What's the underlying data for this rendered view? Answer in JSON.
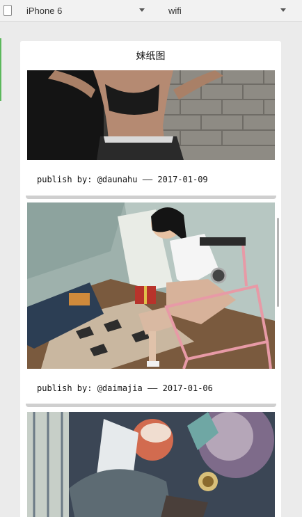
{
  "toolbar": {
    "device": "iPhone 6",
    "network": "wifi"
  },
  "page": {
    "title": "妹纸图"
  },
  "posts": [
    {
      "caption": "publish by: @daunahu —— 2017-01-09"
    },
    {
      "caption": "publish by: @daimajia —— 2017-01-06"
    },
    {
      "caption": ""
    }
  ]
}
